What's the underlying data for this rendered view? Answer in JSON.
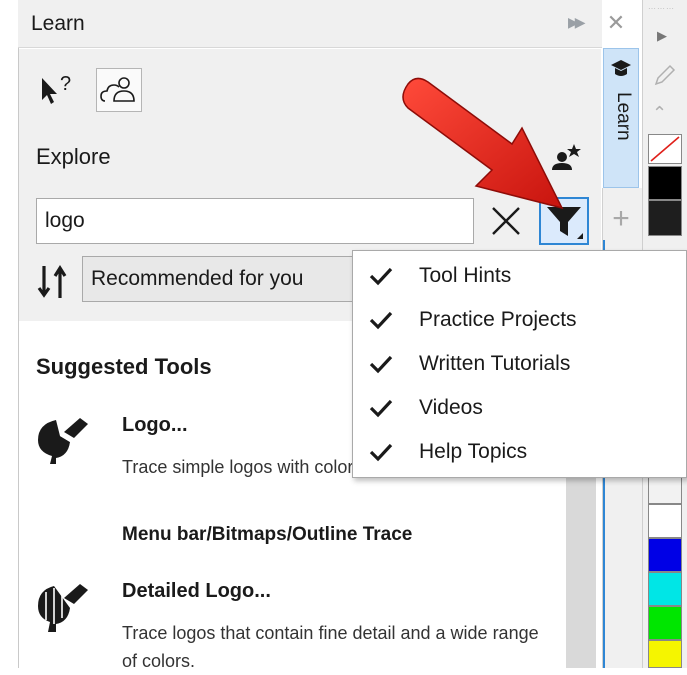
{
  "panel": {
    "title": "Learn",
    "explore_label": "Explore",
    "search": {
      "value": "logo",
      "placeholder": ""
    },
    "sort": {
      "selected": "Recommended for you"
    },
    "suggested_heading": "Suggested Tools",
    "tools": [
      {
        "name": "Logo...",
        "description": "Trace simple logos with colors.",
        "path": "Menu bar/Bitmaps/Outline Trace"
      },
      {
        "name": "Detailed Logo...",
        "description": "Trace logos that contain fine detail and a wide range of colors."
      }
    ]
  },
  "side_tabs": {
    "learn_label": "Learn"
  },
  "filter_menu": {
    "items": [
      {
        "label": "Tool Hints",
        "checked": true
      },
      {
        "label": "Practice Projects",
        "checked": true
      },
      {
        "label": "Written Tutorials",
        "checked": true
      },
      {
        "label": "Videos",
        "checked": true
      },
      {
        "label": "Help Topics",
        "checked": true
      }
    ]
  },
  "palette": {
    "swatches": [
      "none",
      "#000000",
      "#1e1e1e",
      "#f2f2f2",
      "#ffffff",
      "#0000e6",
      "#00e6e6",
      "#00e600",
      "#f5f500"
    ]
  },
  "colors": {
    "accent": "#2e86d4",
    "annotation_arrow": "#e0201a",
    "tab_highlight": "#cfe4f8"
  }
}
